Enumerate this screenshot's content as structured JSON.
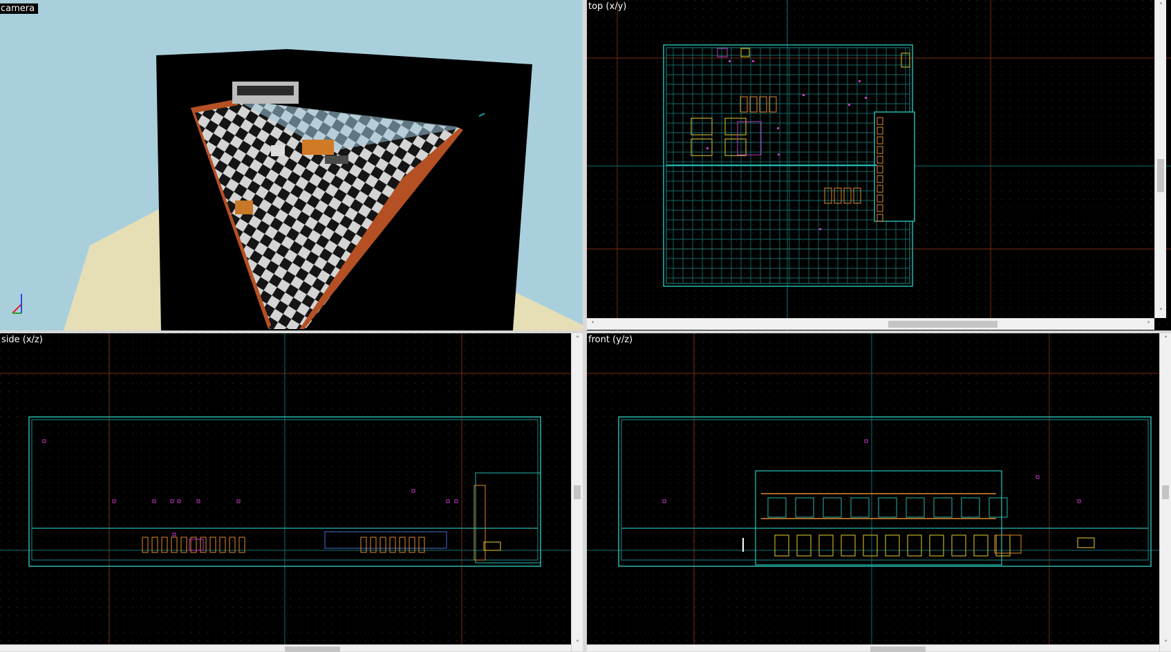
{
  "viewports": {
    "camera": {
      "label": "camera"
    },
    "top": {
      "label": "top (x/y)"
    },
    "side": {
      "label": "side (x/z)"
    },
    "front": {
      "label": "front (y/z)"
    }
  },
  "scroll_glyphs": {
    "up": "˄",
    "down": "˅",
    "left": "˂",
    "right": "˃"
  },
  "colors": {
    "sky": "#a9cfdc",
    "ground": "#e6dfb6",
    "grid_background": "#000000",
    "grid_dots": "#3b3b3b",
    "grid_major": "#7a2d12",
    "axis": "#0b6f74",
    "brush": "#27b7b0",
    "brush_dark": "#1a8d88",
    "prop_orange": "#e58a2c",
    "prop_yellow": "#e6d130",
    "entity_magenta": "#c43ac4",
    "floor_trim": "#b55024",
    "wall_blue": "#4a6fd0"
  }
}
